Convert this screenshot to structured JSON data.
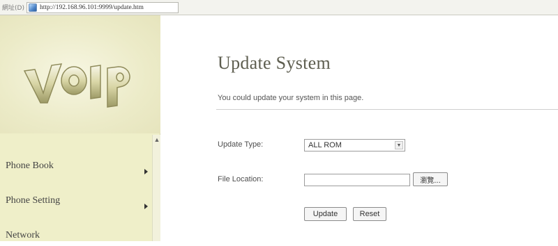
{
  "browser": {
    "address_label": "網址(D)",
    "url": "http://192.168.96.101:9999/update.htm"
  },
  "sidebar": {
    "logo_text": "VOIP",
    "items": [
      {
        "label": "Phone Book"
      },
      {
        "label": "Phone Setting"
      },
      {
        "label": "Network"
      }
    ]
  },
  "main": {
    "title": "Update System",
    "subtitle": "You could update your system in this page.",
    "form": {
      "update_type_label": "Update Type:",
      "update_type_value": "ALL ROM",
      "file_location_label": "File Location:",
      "file_location_value": "",
      "browse_label": "瀏覽...",
      "update_button": "Update",
      "reset_button": "Reset"
    }
  },
  "colors": {
    "sidebar_bg": "#efefc9",
    "title_color": "#5e5e50"
  }
}
